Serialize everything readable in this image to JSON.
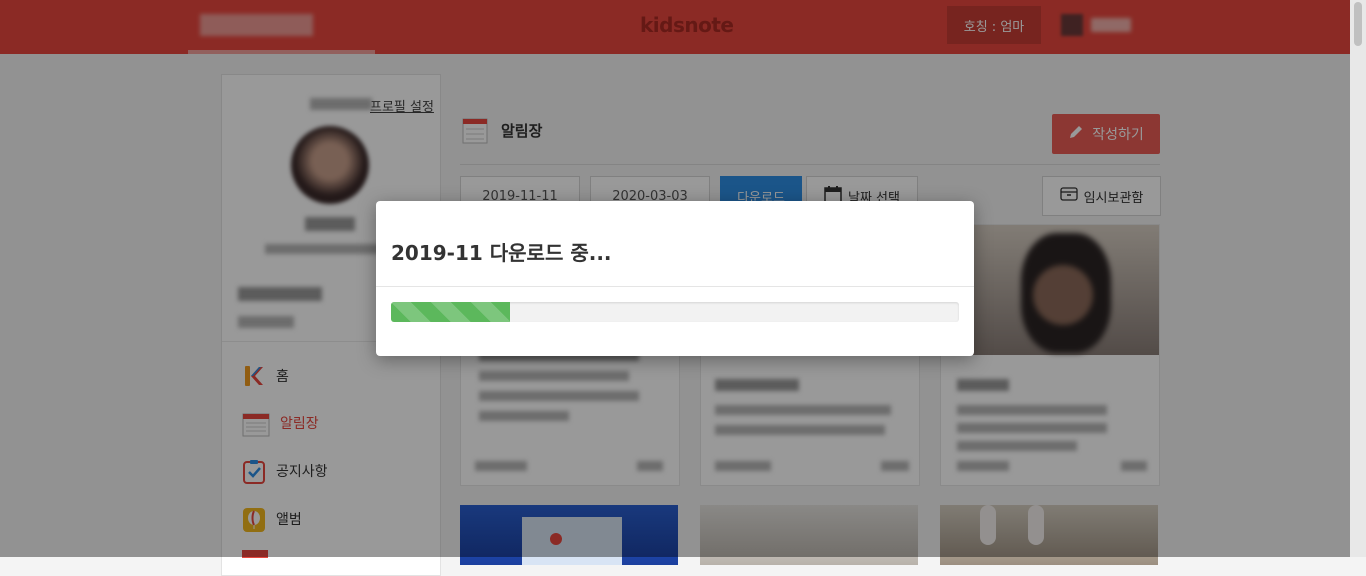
{
  "header": {
    "logo": "kidsnote",
    "nickname": "호칭 : 엄마",
    "accent": "#e8473e"
  },
  "sidebar": {
    "profile_setting": "프로필 설정",
    "menu": [
      {
        "label": "홈",
        "icon": "kidsnote-k-icon"
      },
      {
        "label": "알림장",
        "icon": "notebook-icon",
        "active": true
      },
      {
        "label": "공지사항",
        "icon": "checkbox-clipboard-icon"
      },
      {
        "label": "앨범",
        "icon": "balloon-album-icon"
      }
    ]
  },
  "main": {
    "title": "알림장",
    "write_label": "작성하기",
    "start_date": "2019-11-11",
    "end_date": "2020-03-03",
    "download_label": "다운로드",
    "date_select_label": "날짜 선택",
    "draft_label": "임시보관함"
  },
  "modal": {
    "title": "2019-11 다운로드 중...",
    "progress_percent": 21,
    "progress_color": "#5cb85c"
  }
}
